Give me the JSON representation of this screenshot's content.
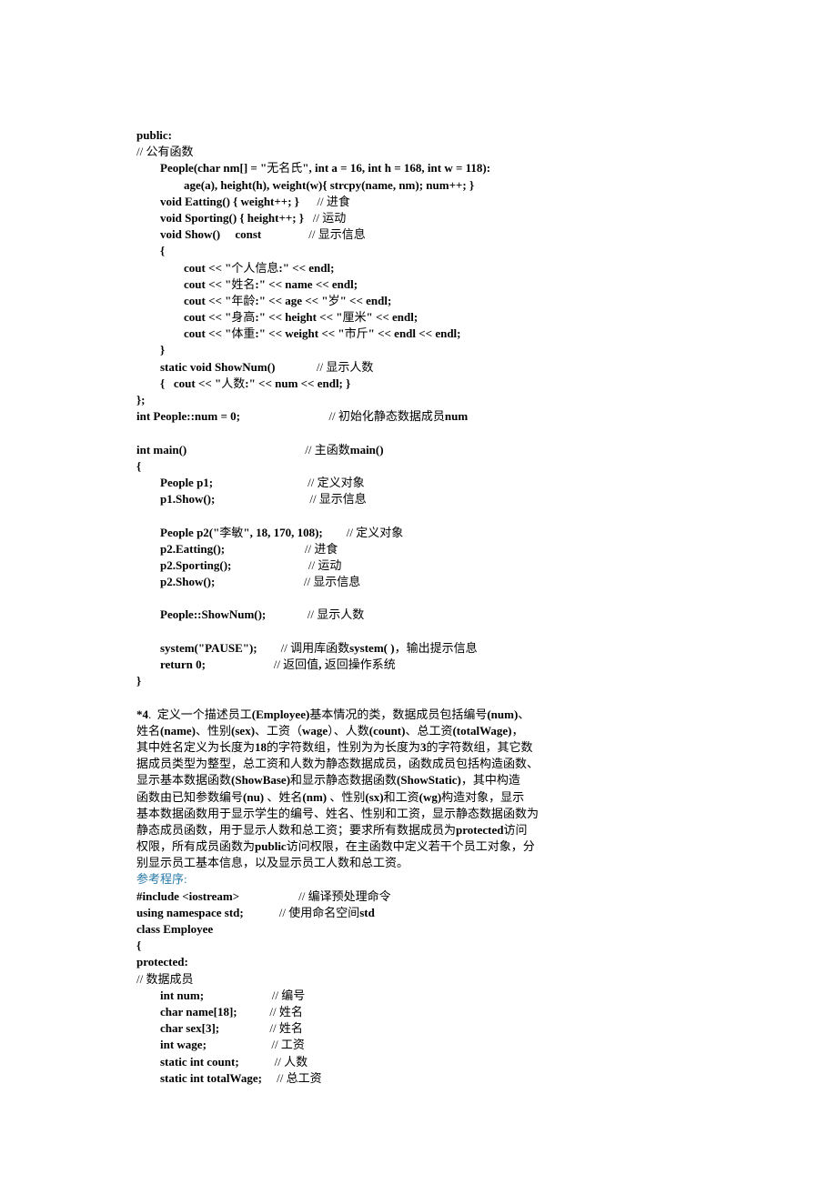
{
  "lines": [
    {
      "segs": [
        {
          "t": "public:",
          "b": 1
        }
      ]
    },
    {
      "segs": [
        {
          "t": "// 公有函数"
        }
      ]
    },
    {
      "segs": [
        {
          "t": "        People(char nm[] = \"",
          "b": 1
        },
        {
          "t": "无名氏"
        },
        {
          "t": "\", int a = 16, int h = 168, int w = 118):",
          "b": 1
        }
      ]
    },
    {
      "segs": [
        {
          "t": "                age(a), height(h), weight(w){ strcpy(name, nm); num++; }",
          "b": 1
        }
      ]
    },
    {
      "segs": [
        {
          "t": "        void Eatting() { weight++; }",
          "b": 1
        },
        {
          "t": "      // 进食"
        }
      ]
    },
    {
      "segs": [
        {
          "t": "        void Sporting() { height++; }",
          "b": 1
        },
        {
          "t": "   // 运动"
        }
      ]
    },
    {
      "segs": [
        {
          "t": "        void Show()     const",
          "b": 1
        },
        {
          "t": "                // 显示信息"
        }
      ]
    },
    {
      "segs": [
        {
          "t": "        {",
          "b": 1
        }
      ]
    },
    {
      "segs": [
        {
          "t": "                cout << \"",
          "b": 1
        },
        {
          "t": "个人信息"
        },
        {
          "t": ":\" << endl;",
          "b": 1
        }
      ]
    },
    {
      "segs": [
        {
          "t": "                cout << \"",
          "b": 1
        },
        {
          "t": "姓名"
        },
        {
          "t": ":\" << name << endl;",
          "b": 1
        }
      ]
    },
    {
      "segs": [
        {
          "t": "                cout << \"",
          "b": 1
        },
        {
          "t": "年龄"
        },
        {
          "t": ":\" << age << \"",
          "b": 1
        },
        {
          "t": "岁"
        },
        {
          "t": "\" << endl;",
          "b": 1
        }
      ]
    },
    {
      "segs": [
        {
          "t": "                cout << \"",
          "b": 1
        },
        {
          "t": "身高"
        },
        {
          "t": ":\" << height << \"",
          "b": 1
        },
        {
          "t": "厘米"
        },
        {
          "t": "\" << endl;",
          "b": 1
        }
      ]
    },
    {
      "segs": [
        {
          "t": "                cout << \"",
          "b": 1
        },
        {
          "t": "体重"
        },
        {
          "t": ":\" << weight << \"",
          "b": 1
        },
        {
          "t": "市斤"
        },
        {
          "t": "\" << endl << endl;",
          "b": 1
        }
      ]
    },
    {
      "segs": [
        {
          "t": "        }",
          "b": 1
        }
      ]
    },
    {
      "segs": [
        {
          "t": "        static void ShowNum()",
          "b": 1
        },
        {
          "t": "              // 显示人数"
        }
      ]
    },
    {
      "segs": [
        {
          "t": "        {   cout << \"",
          "b": 1
        },
        {
          "t": "人数"
        },
        {
          "t": ":\" << num << endl; }",
          "b": 1
        }
      ]
    },
    {
      "segs": [
        {
          "t": "};",
          "b": 1
        }
      ]
    },
    {
      "segs": [
        {
          "t": "int People::num = 0;",
          "b": 1
        },
        {
          "t": "                              // 初始化静态数据成员"
        },
        {
          "t": "num",
          "b": 1
        }
      ]
    },
    {
      "segs": [
        {
          "t": " "
        }
      ]
    },
    {
      "segs": [
        {
          "t": "int main()",
          "b": 1
        },
        {
          "t": "                                        // 主函数"
        },
        {
          "t": "main()",
          "b": 1
        }
      ]
    },
    {
      "segs": [
        {
          "t": "{",
          "b": 1
        }
      ]
    },
    {
      "segs": [
        {
          "t": "        People p1;",
          "b": 1
        },
        {
          "t": "                                // 定义对象"
        }
      ]
    },
    {
      "segs": [
        {
          "t": "        p1.Show();",
          "b": 1
        },
        {
          "t": "                                // 显示信息"
        }
      ]
    },
    {
      "segs": [
        {
          "t": " "
        }
      ]
    },
    {
      "segs": [
        {
          "t": "        People p2(\"",
          "b": 1
        },
        {
          "t": "李敏"
        },
        {
          "t": "\", 18, 170, 108);",
          "b": 1
        },
        {
          "t": "        // 定义对象"
        }
      ]
    },
    {
      "segs": [
        {
          "t": "        p2.Eatting();",
          "b": 1
        },
        {
          "t": "                           // 进食"
        }
      ]
    },
    {
      "segs": [
        {
          "t": "        p2.Sporting();",
          "b": 1
        },
        {
          "t": "                          // 运动"
        }
      ]
    },
    {
      "segs": [
        {
          "t": "        p2.Show();",
          "b": 1
        },
        {
          "t": "                              // 显示信息"
        }
      ]
    },
    {
      "segs": [
        {
          "t": " "
        }
      ]
    },
    {
      "segs": [
        {
          "t": "        People::ShowNum();",
          "b": 1
        },
        {
          "t": "              // 显示人数"
        }
      ]
    },
    {
      "segs": [
        {
          "t": " "
        }
      ]
    },
    {
      "segs": [
        {
          "t": "        system(\"PAUSE\");",
          "b": 1
        },
        {
          "t": "        // 调用库函数"
        },
        {
          "t": "system( )",
          "b": 1
        },
        {
          "t": "，输出提示信息"
        }
      ]
    },
    {
      "segs": [
        {
          "t": "        return 0;",
          "b": 1
        },
        {
          "t": "                       // 返回值"
        },
        {
          "t": ",",
          "b": 1
        },
        {
          "t": " 返回操作系统"
        }
      ]
    },
    {
      "segs": [
        {
          "t": "}",
          "b": 1
        }
      ]
    },
    {
      "segs": [
        {
          "t": " "
        }
      ]
    },
    {
      "segs": [
        {
          "t": "*4",
          "b": 1
        },
        {
          "t": ".  定义一个描述员工"
        },
        {
          "t": "(Employee)",
          "b": 1
        },
        {
          "t": "基本情况的类，数据成员包括编号"
        },
        {
          "t": "(num)",
          "b": 1
        },
        {
          "t": "、"
        }
      ]
    },
    {
      "segs": [
        {
          "t": "姓名"
        },
        {
          "t": "(name)",
          "b": 1
        },
        {
          "t": "、性别"
        },
        {
          "t": "(sex)",
          "b": 1
        },
        {
          "t": "、工资（"
        },
        {
          "t": "wage",
          "b": 1
        },
        {
          "t": "）、人数"
        },
        {
          "t": "(count)",
          "b": 1
        },
        {
          "t": "、总工资"
        },
        {
          "t": "(totalWage)",
          "b": 1
        },
        {
          "t": "，"
        }
      ]
    },
    {
      "segs": [
        {
          "t": "其中姓名定义为长度为"
        },
        {
          "t": "18",
          "b": 1
        },
        {
          "t": "的字符数组，性别为为长度为"
        },
        {
          "t": "3",
          "b": 1
        },
        {
          "t": "的字符数组，其它数"
        }
      ]
    },
    {
      "segs": [
        {
          "t": "据成员类型为整型，总工资和人数为静态数据成员，函数成员包括构造函数、"
        }
      ]
    },
    {
      "segs": [
        {
          "t": "显示基本数据函数"
        },
        {
          "t": "(ShowBase)",
          "b": 1
        },
        {
          "t": "和显示静态数据函数"
        },
        {
          "t": "(ShowStatic)",
          "b": 1
        },
        {
          "t": "，其中构造"
        }
      ]
    },
    {
      "segs": [
        {
          "t": "函数由已知参数编号"
        },
        {
          "t": "(nu) ",
          "b": 1
        },
        {
          "t": "、姓名"
        },
        {
          "t": "(nm) ",
          "b": 1
        },
        {
          "t": "、性别"
        },
        {
          "t": "(sx)",
          "b": 1
        },
        {
          "t": "和工资"
        },
        {
          "t": "(wg)",
          "b": 1
        },
        {
          "t": "构造对象，显示"
        }
      ]
    },
    {
      "segs": [
        {
          "t": "基本数据函数用于显示学生的编号、姓名、性别和工资，显示静态数据函数为"
        }
      ]
    },
    {
      "segs": [
        {
          "t": "静态成员函数，用于显示人数和总工资；要求所有数据成员为"
        },
        {
          "t": "protected",
          "b": 1
        },
        {
          "t": "访问"
        }
      ]
    },
    {
      "segs": [
        {
          "t": "权限，所有成员函数为"
        },
        {
          "t": "public",
          "b": 1
        },
        {
          "t": "访问权限，在主函数中定义若干个员工对象，分"
        }
      ]
    },
    {
      "segs": [
        {
          "t": "别显示员工基本信息，以及显示员工人数和总工资。"
        }
      ]
    },
    {
      "segs": [
        {
          "t": "参考程序:",
          "c": "label"
        }
      ]
    },
    {
      "segs": [
        {
          "t": "#include <iostream>",
          "b": 1
        },
        {
          "t": "                    // 编译预处理命令"
        }
      ]
    },
    {
      "segs": [
        {
          "t": "using namespace std;",
          "b": 1
        },
        {
          "t": "            // 使用命名空间"
        },
        {
          "t": "std",
          "b": 1
        }
      ]
    },
    {
      "segs": [
        {
          "t": "class Employee",
          "b": 1
        }
      ]
    },
    {
      "segs": [
        {
          "t": "{",
          "b": 1
        }
      ]
    },
    {
      "segs": [
        {
          "t": "protected:",
          "b": 1
        }
      ]
    },
    {
      "segs": [
        {
          "t": "// 数据成员"
        }
      ]
    },
    {
      "segs": [
        {
          "t": "        int num;",
          "b": 1
        },
        {
          "t": "                       // 编号"
        }
      ]
    },
    {
      "segs": [
        {
          "t": "        char name[18];",
          "b": 1
        },
        {
          "t": "           // 姓名"
        }
      ]
    },
    {
      "segs": [
        {
          "t": "        char sex[3];",
          "b": 1
        },
        {
          "t": "                 // 姓名"
        }
      ]
    },
    {
      "segs": [
        {
          "t": "        int wage;",
          "b": 1
        },
        {
          "t": "                      // 工资"
        }
      ]
    },
    {
      "segs": [
        {
          "t": "        static int count;",
          "b": 1
        },
        {
          "t": "            // 人数"
        }
      ]
    },
    {
      "segs": [
        {
          "t": "        static int totalWage;",
          "b": 1
        },
        {
          "t": "     // 总工资"
        }
      ]
    }
  ]
}
